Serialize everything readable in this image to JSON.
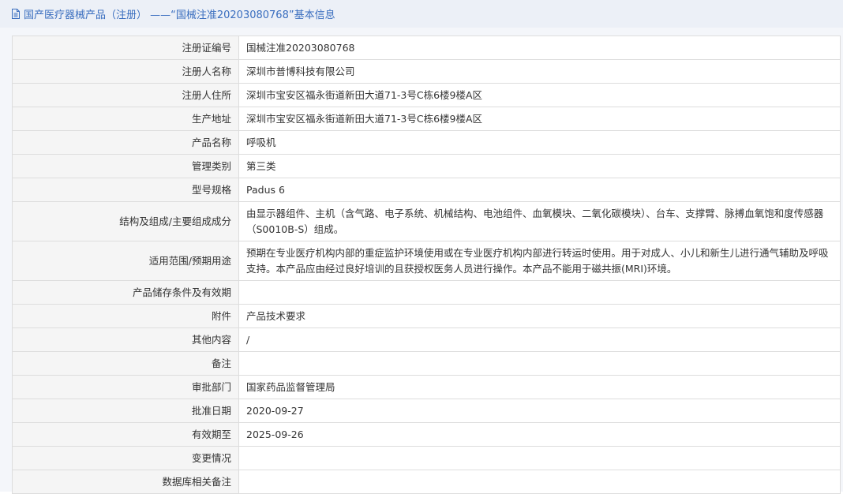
{
  "header": {
    "title": "国产医疗器械产品（注册） ——“国械注准20203080768”基本信息",
    "icon": "document-icon"
  },
  "colors": {
    "accent": "#3a6ebf",
    "header_bg": "#ecf0f7",
    "label_bg": "#f5f5f5",
    "border": "#dddddd"
  },
  "rows": [
    {
      "label": "注册证编号",
      "value": "国械注准20203080768"
    },
    {
      "label": "注册人名称",
      "value": "深圳市普博科技有限公司"
    },
    {
      "label": "注册人住所",
      "value": "深圳市宝安区福永街道新田大道71-3号C栋6楼9楼A区"
    },
    {
      "label": "生产地址",
      "value": "深圳市宝安区福永街道新田大道71-3号C栋6楼9楼A区"
    },
    {
      "label": "产品名称",
      "value": "呼吸机"
    },
    {
      "label": "管理类别",
      "value": "第三类"
    },
    {
      "label": "型号规格",
      "value": "Padus 6"
    },
    {
      "label": "结构及组成/主要组成成分",
      "value": "由显示器组件、主机（含气路、电子系统、机械结构、电池组件、血氧模块、二氧化碳模块）、台车、支撑臂、脉搏血氧饱和度传感器（S0010B-S）组成。"
    },
    {
      "label": "适用范围/预期用途",
      "value": "预期在专业医疗机构内部的重症监护环境使用或在专业医疗机构内部进行转运时使用。用于对成人、小儿和新生儿进行通气辅助及呼吸支持。本产品应由经过良好培训的且获授权医务人员进行操作。本产品不能用于磁共振(MRI)环境。"
    },
    {
      "label": "产品储存条件及有效期",
      "value": ""
    },
    {
      "label": "附件",
      "value": "产品技术要求"
    },
    {
      "label": "其他内容",
      "value": "/"
    },
    {
      "label": "备注",
      "value": ""
    },
    {
      "label": "审批部门",
      "value": "国家药品监督管理局"
    },
    {
      "label": "批准日期",
      "value": "2020-09-27"
    },
    {
      "label": "有效期至",
      "value": "2025-09-26"
    },
    {
      "label": "变更情况",
      "value": ""
    },
    {
      "label": "数据库相关备注",
      "value": ""
    }
  ]
}
